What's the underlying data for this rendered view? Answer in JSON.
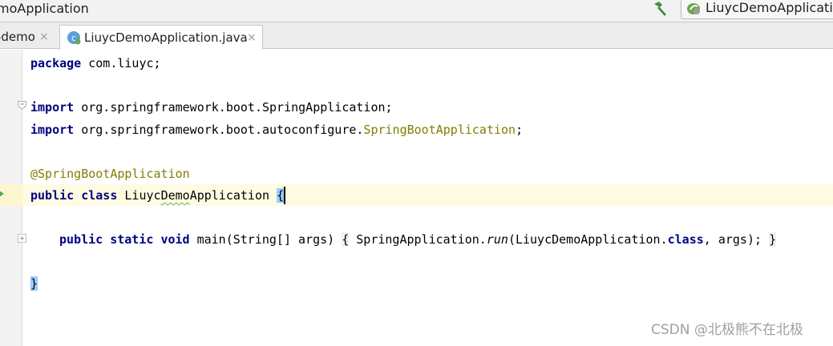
{
  "window": {
    "title": "moApplication"
  },
  "toolbar": {
    "build_icon": "hammer-icon",
    "run_config_label": "LiuycDemoApplication",
    "run_config_icon": "spring-boot-run-config-icon"
  },
  "tabs": [
    {
      "label": "-demo",
      "close": "×",
      "active": false
    },
    {
      "label": "LiuycDemoApplication.java",
      "close": "×",
      "active": true,
      "icon": "java-class-icon"
    }
  ],
  "editor": {
    "lines": {
      "package": {
        "keyword": "package",
        "rest": " com.liuyc;"
      },
      "import1": {
        "keyword": "import",
        "rest": " org.springframework.boot.SpringApplication;"
      },
      "import2": {
        "keyword": "import",
        "rest_a": " org.springframework.boot.autoconfigure.",
        "unused": "SpringBootApplication",
        "rest_b": ";"
      },
      "annotation": "@SpringBootApplication",
      "class_decl": {
        "kw1": "public",
        "kw2": "class",
        "name_a": "Liuyc",
        "name_b": "Demo",
        "name_c": "Application ",
        "brace": "{"
      },
      "main": {
        "kw1": "public",
        "kw2": "static",
        "kw3": "void",
        "sig": " main(String[] args) ",
        "open": "{",
        "call_a": " SpringApplication.",
        "call_run": "run",
        "call_b": "(LiuycDemoApplication.",
        "call_class": "class",
        "call_c": ", args); ",
        "close": "}"
      },
      "class_close": "}"
    }
  },
  "watermark": "CSDN @北极熊不在北极",
  "colors": {
    "keyword": "#000080",
    "annotation": "#808000",
    "caret_line": "#fffbe3",
    "brace_match": "#99ccff"
  }
}
